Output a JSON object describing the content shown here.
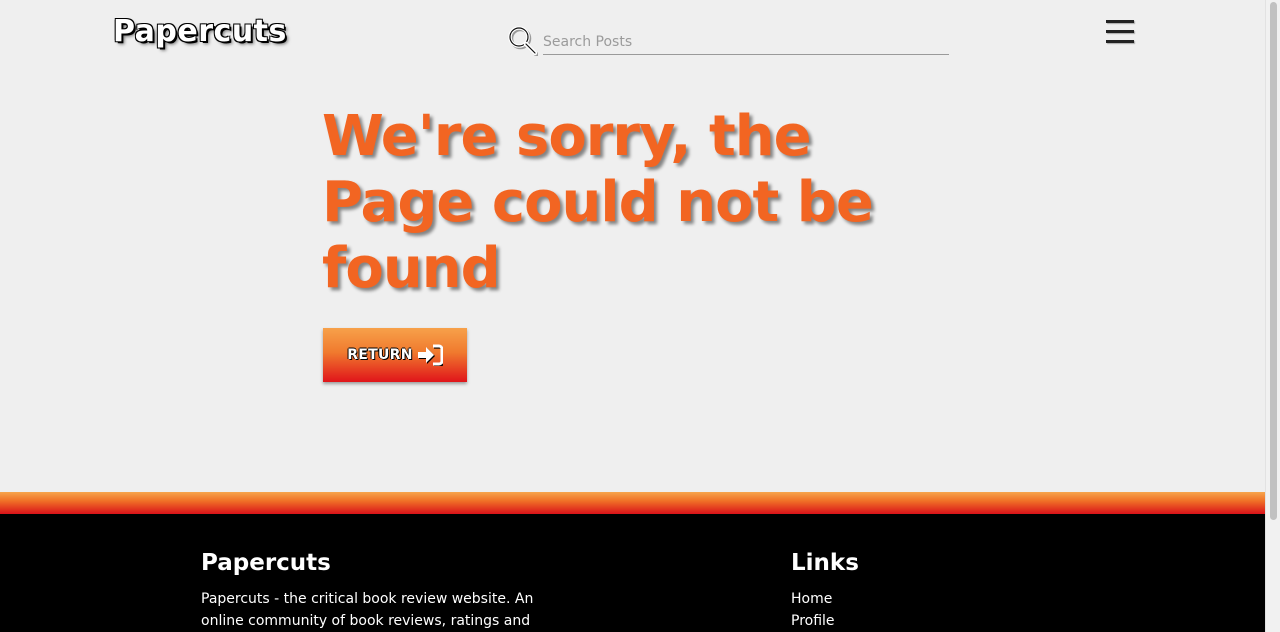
{
  "header": {
    "logo": "Papercuts",
    "search_placeholder": "Search Posts"
  },
  "main": {
    "headline": "We're sorry, the Page could not be found",
    "return_label": "RETURN"
  },
  "footer": {
    "about_title": "Papercuts",
    "about_text": "Papercuts - the critical book review website. An online community of book reviews, ratings and rants.",
    "links_title": "Links",
    "links": [
      "Home",
      "Profile"
    ]
  },
  "colors": {
    "accent_orange": "#f26522",
    "gradient_top": "#f7a14a",
    "gradient_bottom": "#e0141a",
    "footer_bg": "#000000",
    "page_bg": "#efefef"
  },
  "icons": {
    "search": "search-icon",
    "menu": "hamburger-menu-icon",
    "return": "sign-in-arrow-icon"
  }
}
